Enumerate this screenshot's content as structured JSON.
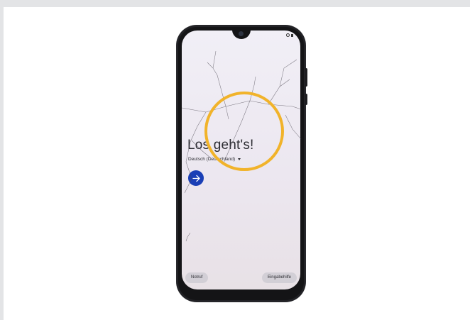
{
  "screen": {
    "welcome_title": "Los geht's!",
    "language": "Deutsch (Deutschland)",
    "emergency_button": "Notruf",
    "accessibility_button": "Eingabehilfe"
  },
  "icons": {
    "next": "arrow-right-icon",
    "language_dropdown": "caret-down-icon"
  },
  "colors": {
    "next_button": "#1a3fb6",
    "highlight_circle": "#f1b32a",
    "phone_body": "#141416"
  }
}
